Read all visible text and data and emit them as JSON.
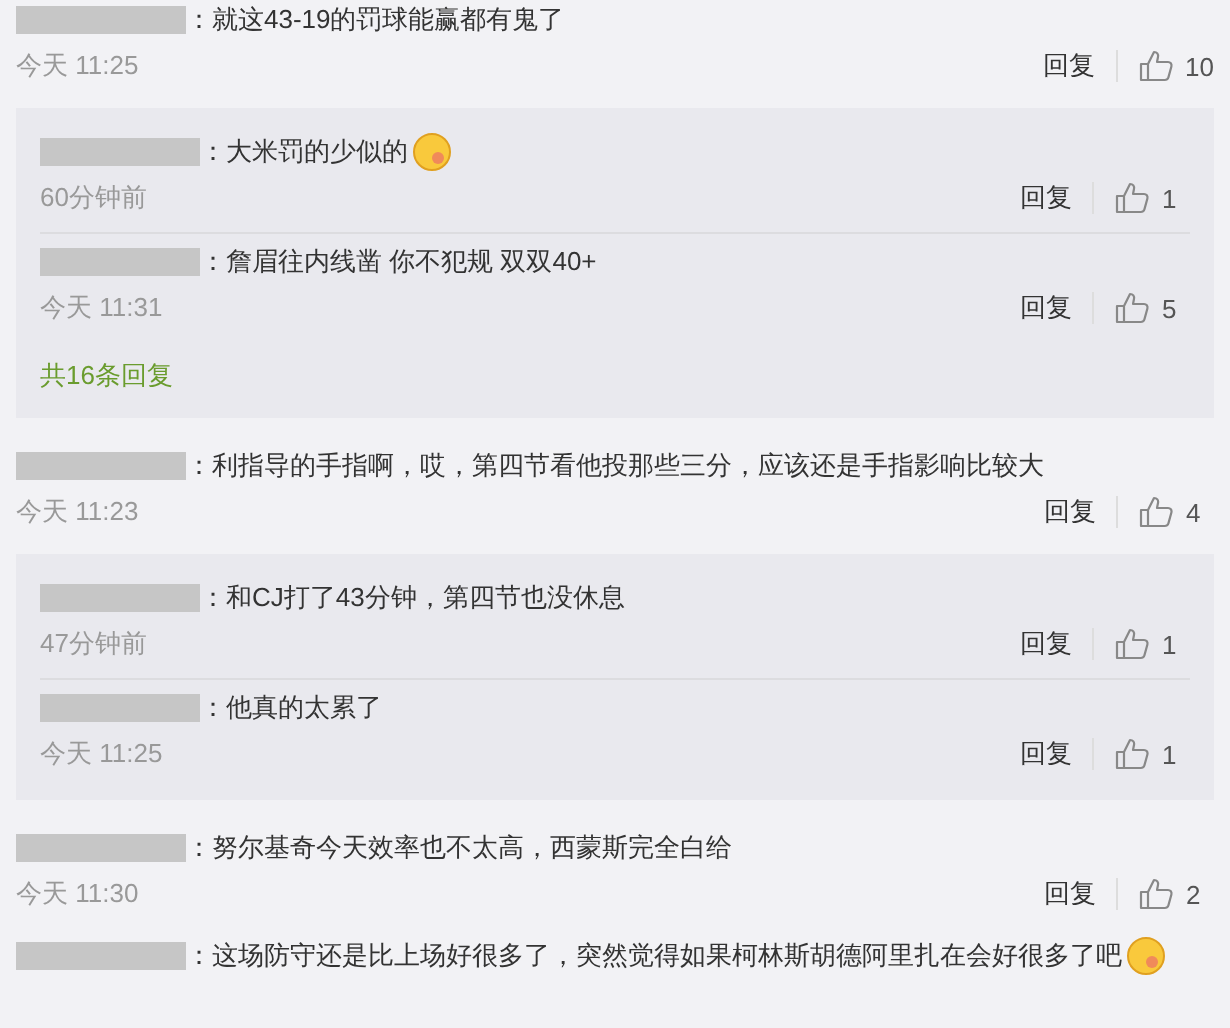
{
  "comments": [
    {
      "text": "：就这43-19的罚球能赢都有鬼了",
      "time": "今天 11:25",
      "reply_label": "回复",
      "likes": "10",
      "emoji": false,
      "replies": [
        {
          "text": "：大米罚的少似的",
          "time": "60分钟前",
          "reply_label": "回复",
          "likes": "1",
          "emoji": true
        },
        {
          "text": "：詹眉往内线凿  你不犯规 双双40+",
          "time": "今天 11:31",
          "reply_label": "回复",
          "likes": "5",
          "emoji": false
        }
      ],
      "more_replies": "共16条回复"
    },
    {
      "text": "：利指导的手指啊，哎，第四节看他投那些三分，应该还是手指影响比较大",
      "time": "今天 11:23",
      "reply_label": "回复",
      "likes": "4",
      "emoji": false,
      "replies": [
        {
          "text": "：和CJ打了43分钟，第四节也没休息",
          "time": "47分钟前",
          "reply_label": "回复",
          "likes": "1",
          "emoji": false
        },
        {
          "text": "：他真的太累了",
          "time": "今天 11:25",
          "reply_label": "回复",
          "likes": "1",
          "emoji": false
        }
      ]
    },
    {
      "text": "：努尔基奇今天效率也不太高，西蒙斯完全白给",
      "time": "今天 11:30",
      "reply_label": "回复",
      "likes": "2",
      "emoji": false
    },
    {
      "text": "：这场防守还是比上场好很多了，突然觉得如果柯林斯胡德阿里扎在会好很多了吧",
      "emoji": true
    }
  ]
}
